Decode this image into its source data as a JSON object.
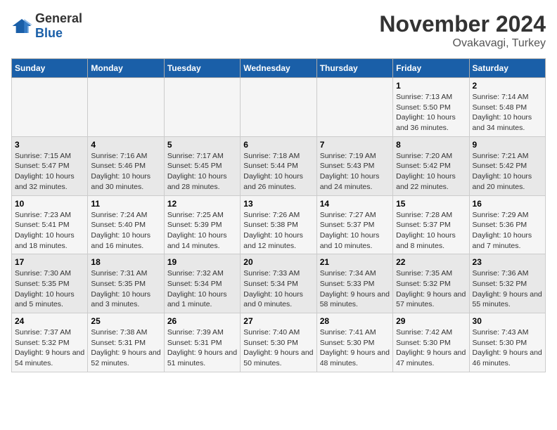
{
  "header": {
    "logo_general": "General",
    "logo_blue": "Blue",
    "month": "November 2024",
    "location": "Ovakavagi, Turkey"
  },
  "days_of_week": [
    "Sunday",
    "Monday",
    "Tuesday",
    "Wednesday",
    "Thursday",
    "Friday",
    "Saturday"
  ],
  "weeks": [
    [
      {
        "day": "",
        "info": ""
      },
      {
        "day": "",
        "info": ""
      },
      {
        "day": "",
        "info": ""
      },
      {
        "day": "",
        "info": ""
      },
      {
        "day": "",
        "info": ""
      },
      {
        "day": "1",
        "info": "Sunrise: 7:13 AM\nSunset: 5:50 PM\nDaylight: 10 hours and 36 minutes."
      },
      {
        "day": "2",
        "info": "Sunrise: 7:14 AM\nSunset: 5:48 PM\nDaylight: 10 hours and 34 minutes."
      }
    ],
    [
      {
        "day": "3",
        "info": "Sunrise: 7:15 AM\nSunset: 5:47 PM\nDaylight: 10 hours and 32 minutes."
      },
      {
        "day": "4",
        "info": "Sunrise: 7:16 AM\nSunset: 5:46 PM\nDaylight: 10 hours and 30 minutes."
      },
      {
        "day": "5",
        "info": "Sunrise: 7:17 AM\nSunset: 5:45 PM\nDaylight: 10 hours and 28 minutes."
      },
      {
        "day": "6",
        "info": "Sunrise: 7:18 AM\nSunset: 5:44 PM\nDaylight: 10 hours and 26 minutes."
      },
      {
        "day": "7",
        "info": "Sunrise: 7:19 AM\nSunset: 5:43 PM\nDaylight: 10 hours and 24 minutes."
      },
      {
        "day": "8",
        "info": "Sunrise: 7:20 AM\nSunset: 5:42 PM\nDaylight: 10 hours and 22 minutes."
      },
      {
        "day": "9",
        "info": "Sunrise: 7:21 AM\nSunset: 5:42 PM\nDaylight: 10 hours and 20 minutes."
      }
    ],
    [
      {
        "day": "10",
        "info": "Sunrise: 7:23 AM\nSunset: 5:41 PM\nDaylight: 10 hours and 18 minutes."
      },
      {
        "day": "11",
        "info": "Sunrise: 7:24 AM\nSunset: 5:40 PM\nDaylight: 10 hours and 16 minutes."
      },
      {
        "day": "12",
        "info": "Sunrise: 7:25 AM\nSunset: 5:39 PM\nDaylight: 10 hours and 14 minutes."
      },
      {
        "day": "13",
        "info": "Sunrise: 7:26 AM\nSunset: 5:38 PM\nDaylight: 10 hours and 12 minutes."
      },
      {
        "day": "14",
        "info": "Sunrise: 7:27 AM\nSunset: 5:37 PM\nDaylight: 10 hours and 10 minutes."
      },
      {
        "day": "15",
        "info": "Sunrise: 7:28 AM\nSunset: 5:37 PM\nDaylight: 10 hours and 8 minutes."
      },
      {
        "day": "16",
        "info": "Sunrise: 7:29 AM\nSunset: 5:36 PM\nDaylight: 10 hours and 7 minutes."
      }
    ],
    [
      {
        "day": "17",
        "info": "Sunrise: 7:30 AM\nSunset: 5:35 PM\nDaylight: 10 hours and 5 minutes."
      },
      {
        "day": "18",
        "info": "Sunrise: 7:31 AM\nSunset: 5:35 PM\nDaylight: 10 hours and 3 minutes."
      },
      {
        "day": "19",
        "info": "Sunrise: 7:32 AM\nSunset: 5:34 PM\nDaylight: 10 hours and 1 minute."
      },
      {
        "day": "20",
        "info": "Sunrise: 7:33 AM\nSunset: 5:34 PM\nDaylight: 10 hours and 0 minutes."
      },
      {
        "day": "21",
        "info": "Sunrise: 7:34 AM\nSunset: 5:33 PM\nDaylight: 9 hours and 58 minutes."
      },
      {
        "day": "22",
        "info": "Sunrise: 7:35 AM\nSunset: 5:32 PM\nDaylight: 9 hours and 57 minutes."
      },
      {
        "day": "23",
        "info": "Sunrise: 7:36 AM\nSunset: 5:32 PM\nDaylight: 9 hours and 55 minutes."
      }
    ],
    [
      {
        "day": "24",
        "info": "Sunrise: 7:37 AM\nSunset: 5:32 PM\nDaylight: 9 hours and 54 minutes."
      },
      {
        "day": "25",
        "info": "Sunrise: 7:38 AM\nSunset: 5:31 PM\nDaylight: 9 hours and 52 minutes."
      },
      {
        "day": "26",
        "info": "Sunrise: 7:39 AM\nSunset: 5:31 PM\nDaylight: 9 hours and 51 minutes."
      },
      {
        "day": "27",
        "info": "Sunrise: 7:40 AM\nSunset: 5:30 PM\nDaylight: 9 hours and 50 minutes."
      },
      {
        "day": "28",
        "info": "Sunrise: 7:41 AM\nSunset: 5:30 PM\nDaylight: 9 hours and 48 minutes."
      },
      {
        "day": "29",
        "info": "Sunrise: 7:42 AM\nSunset: 5:30 PM\nDaylight: 9 hours and 47 minutes."
      },
      {
        "day": "30",
        "info": "Sunrise: 7:43 AM\nSunset: 5:30 PM\nDaylight: 9 hours and 46 minutes."
      }
    ]
  ]
}
